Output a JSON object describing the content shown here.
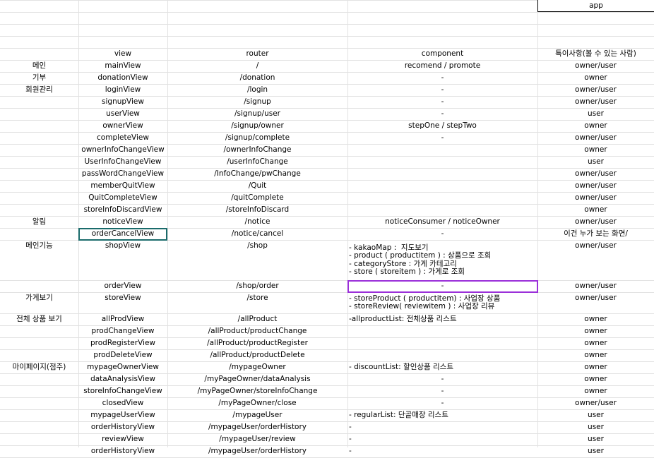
{
  "header_app": "app",
  "columns": {
    "view": "view",
    "router": "router",
    "component": "component",
    "note": "특이사항(볼 수 있는 사람)"
  },
  "rows": [
    {
      "cat": "메인",
      "view": "mainView",
      "router": "/",
      "comp": [
        "recomend / promote"
      ],
      "note": "owner/user",
      "compAlign": "center"
    },
    {
      "cat": "기부",
      "view": "donationView",
      "router": "/donation",
      "comp": [
        "-"
      ],
      "note": "owner",
      "compAlign": "center"
    },
    {
      "cat": "회원관리",
      "view": "loginView",
      "router": "/login",
      "comp": [
        "-"
      ],
      "note": "owner/user",
      "compAlign": "center"
    },
    {
      "cat": "",
      "view": "signupView",
      "router": "/signup",
      "comp": [
        "-"
      ],
      "note": "owner/user",
      "compAlign": "center"
    },
    {
      "cat": "",
      "view": "userView",
      "router": "/signup/user",
      "comp": [
        "-"
      ],
      "note": "user",
      "compAlign": "center"
    },
    {
      "cat": "",
      "view": "ownerView",
      "router": "/signup/owner",
      "comp": [
        "stepOne / stepTwo"
      ],
      "note": "owner",
      "compAlign": "center"
    },
    {
      "cat": "",
      "view": "completeView",
      "router": "/signup/complete",
      "comp": [
        "-"
      ],
      "note": "owner/user",
      "compAlign": "center"
    },
    {
      "cat": "",
      "view": "ownerInfoChangeView",
      "router": "/ownerInfoChange",
      "comp": [
        ""
      ],
      "note": "owner",
      "compAlign": "center"
    },
    {
      "cat": "",
      "view": "UserInfoChangeView",
      "router": "/userInfoChange",
      "comp": [
        ""
      ],
      "note": "user",
      "compAlign": "center"
    },
    {
      "cat": "",
      "view": "passWordChangeView",
      "router": "/InfoChange/pwChange",
      "comp": [
        ""
      ],
      "note": "owner/user",
      "compAlign": "center"
    },
    {
      "cat": "",
      "view": "memberQuitView",
      "router": "/Quit",
      "comp": [
        ""
      ],
      "note": "owner/user",
      "compAlign": "center"
    },
    {
      "cat": "",
      "view": "QuitCompleteView",
      "router": "/quitComplete",
      "comp": [
        ""
      ],
      "note": "owner/user",
      "compAlign": "center"
    },
    {
      "cat": "",
      "view": "storeInfoDiscardView",
      "router": "/storeInfoDiscard",
      "comp": [
        ""
      ],
      "note": "owner",
      "compAlign": "center"
    },
    {
      "cat": "알림",
      "view": "noticeView",
      "router": "/notice",
      "comp": [
        "noticeConsumer / noticeOwner"
      ],
      "note": "owner/user",
      "compAlign": "center"
    },
    {
      "cat": "",
      "view": "orderCancelView",
      "router": "/notice/cancel",
      "comp": [
        "-"
      ],
      "note": "이건 누가 보는 화면/",
      "compAlign": "center"
    },
    {
      "cat": "메인기능",
      "view": "shopView",
      "router": "/shop",
      "comp": [
        "- kakaoMap :  지도보기",
        "- product ( productitem ) : 상품으로 조회",
        "- categoryStore : 가게 카테고리",
        "- store ( storeitem ) : 가게로 조회"
      ],
      "note": "owner/user",
      "compAlign": "left"
    },
    {
      "cat": "",
      "view": "orderView",
      "router": "/shop/order",
      "comp": [
        "-"
      ],
      "note": "owner/user",
      "compAlign": "center"
    },
    {
      "cat": "가게보기",
      "view": "storeView",
      "router": "/store",
      "comp": [
        "- storeProduct ( productitem) : 사업장 상품",
        "- storeReview( reviewitem ) : 사업장 리뷰"
      ],
      "note": "owner/user",
      "compAlign": "left"
    },
    {
      "cat": "전체 상품 보기",
      "view": "allProdView",
      "router": "/allProduct",
      "comp": [
        "-allproductList: 전체상품 리스트"
      ],
      "note": "owner",
      "compAlign": "left"
    },
    {
      "cat": "",
      "view": "prodChangeView",
      "router": "/allProduct/productChange",
      "comp": [
        ""
      ],
      "note": "owner",
      "compAlign": "center"
    },
    {
      "cat": "",
      "view": "prodRegisterView",
      "router": "/allProduct/productRegister",
      "comp": [
        ""
      ],
      "note": "owner",
      "compAlign": "center"
    },
    {
      "cat": "",
      "view": "prodDeleteView",
      "router": "/allProduct/productDelete",
      "comp": [
        ""
      ],
      "note": "owner",
      "compAlign": "center"
    },
    {
      "cat": "마이페이지(점주)",
      "view": "mypageOwnerView",
      "router": "/mypageOwner",
      "comp": [
        "- discountList: 할인상품 리스트"
      ],
      "note": "owner",
      "compAlign": "left"
    },
    {
      "cat": "",
      "view": "dataAnalysisView",
      "router": "/myPageOwner/dataAnalysis",
      "comp": [
        "-"
      ],
      "note": "owner",
      "compAlign": "center"
    },
    {
      "cat": "",
      "view": "storeInfoChangeView",
      "router": "/myPageOwner/storeInfoChange",
      "comp": [
        "-"
      ],
      "note": "owner",
      "compAlign": "center"
    },
    {
      "cat": "",
      "view": "closedView",
      "router": "/myPageOwner/close",
      "comp": [
        "-"
      ],
      "note": "owner/user",
      "compAlign": "center"
    },
    {
      "cat": "",
      "view": "mypageUserView",
      "router": "/mypageUser",
      "comp": [
        "- regularList: 단골매장 리스트"
      ],
      "note": "user",
      "compAlign": "left"
    },
    {
      "cat": "",
      "view": "orderHistoryView",
      "router": "/mypageUser/orderHistory",
      "comp": [
        "-"
      ],
      "note": "user",
      "compAlign": "left"
    },
    {
      "cat": "",
      "view": "reviewView",
      "router": "/mypageUser/review",
      "comp": [
        "-"
      ],
      "note": "user",
      "compAlign": "left"
    },
    {
      "cat": "",
      "view": "orderHistoryView",
      "router": "/mypageUser/orderHistory",
      "comp": [
        "-"
      ],
      "note": "user",
      "compAlign": "left"
    }
  ]
}
